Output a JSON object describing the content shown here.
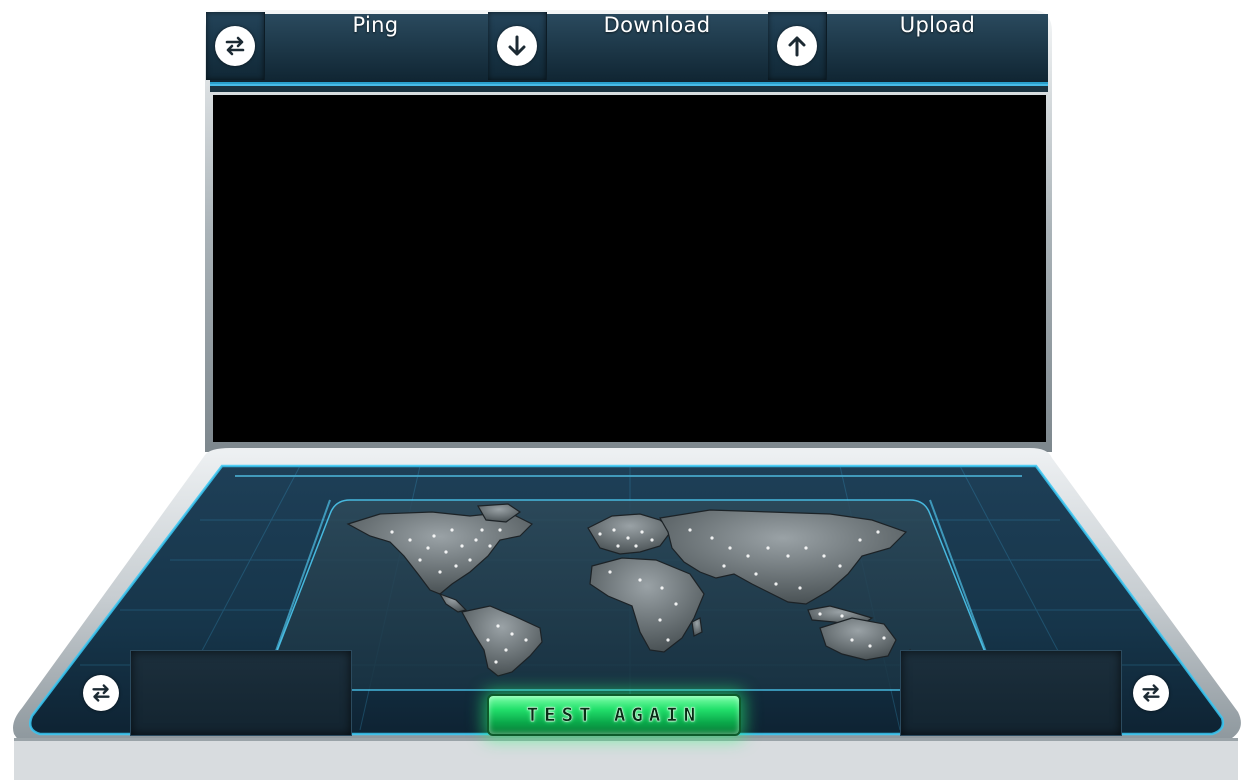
{
  "header": {
    "metrics": [
      {
        "label": "Ping",
        "icon": "ping-arrows-icon"
      },
      {
        "label": "Download",
        "icon": "download-arrow-icon"
      },
      {
        "label": "Upload",
        "icon": "upload-arrow-icon"
      }
    ]
  },
  "screen": {
    "content": ""
  },
  "dashboard": {
    "map": "world-map",
    "left_box": {
      "icon": "ping-arrows-icon",
      "value": ""
    },
    "right_box": {
      "icon": "ping-arrows-icon",
      "value": ""
    },
    "action_button": {
      "label": "TEST AGAIN"
    }
  },
  "colors": {
    "accent_glow": "#2fd0ff",
    "panel_dark": "#132430",
    "button_green": "#22e06b",
    "bezel": "#b9c1c6"
  }
}
